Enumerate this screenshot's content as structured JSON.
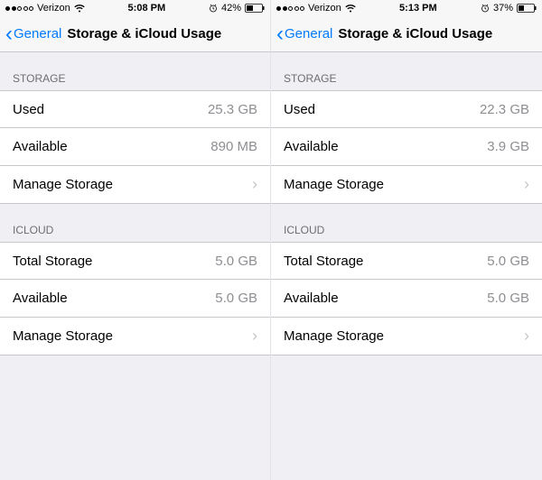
{
  "screens": [
    {
      "status": {
        "signal_filled": 2,
        "carrier": "Verizon",
        "time": "5:08 PM",
        "battery_percent": "42%"
      },
      "nav": {
        "back": "General",
        "title": "Storage & iCloud Usage"
      },
      "storage": {
        "header": "STORAGE",
        "used_label": "Used",
        "used_value": "25.3 GB",
        "available_label": "Available",
        "available_value": "890 MB",
        "manage_label": "Manage Storage"
      },
      "icloud": {
        "header": "ICLOUD",
        "total_label": "Total Storage",
        "total_value": "5.0 GB",
        "available_label": "Available",
        "available_value": "5.0 GB",
        "manage_label": "Manage Storage"
      }
    },
    {
      "status": {
        "signal_filled": 2,
        "carrier": "Verizon",
        "time": "5:13 PM",
        "battery_percent": "37%"
      },
      "nav": {
        "back": "General",
        "title": "Storage & iCloud Usage"
      },
      "storage": {
        "header": "STORAGE",
        "used_label": "Used",
        "used_value": "22.3 GB",
        "available_label": "Available",
        "available_value": "3.9 GB",
        "manage_label": "Manage Storage"
      },
      "icloud": {
        "header": "ICLOUD",
        "total_label": "Total Storage",
        "total_value": "5.0 GB",
        "available_label": "Available",
        "available_value": "5.0 GB",
        "manage_label": "Manage Storage"
      }
    }
  ]
}
